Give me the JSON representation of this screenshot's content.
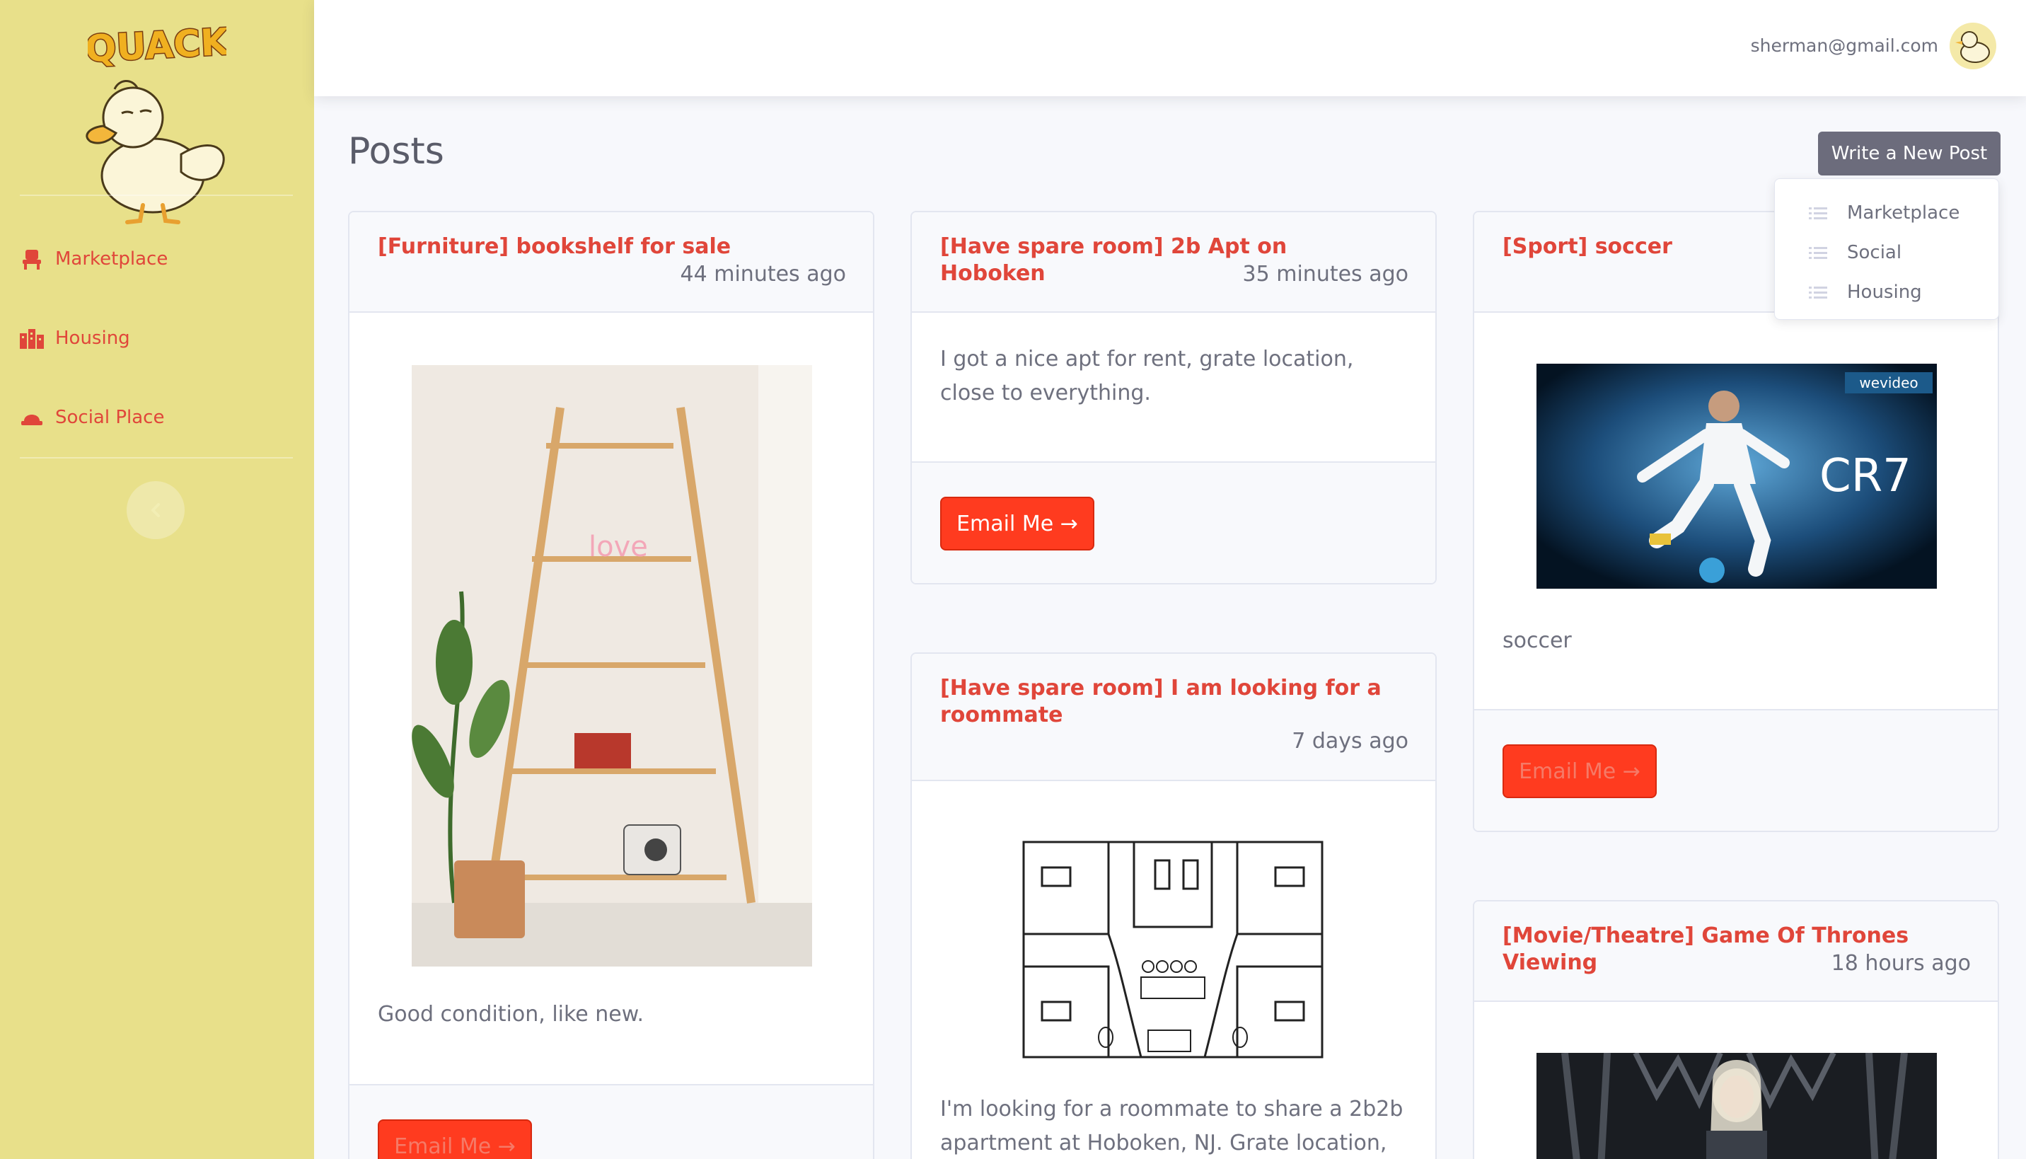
{
  "sidebar": {
    "logo_text": "QUACK",
    "items": [
      {
        "label": "Marketplace",
        "icon": "chair-icon"
      },
      {
        "label": "Housing",
        "icon": "city-icon"
      },
      {
        "label": "Social Place",
        "icon": "hat-icon"
      }
    ]
  },
  "topbar": {
    "user_email": "sherman@gmail.com"
  },
  "main": {
    "title": "Posts",
    "write_button": "Write a New Post",
    "dropdown": [
      "Marketplace",
      "Social",
      "Housing"
    ],
    "posts": [
      {
        "title": "[Furniture] bookshelf for sale",
        "time": "44 minutes ago",
        "body": "Good condition, like new.",
        "button": "Email Me →"
      },
      {
        "title": "[Have spare room] 2b Apt on Hoboken",
        "time": "35 minutes ago",
        "body": "I got a nice apt for rent, grate location, close to everything.",
        "button": "Email Me →"
      },
      {
        "title": "[Sport] soccer",
        "time": "",
        "body": "soccer",
        "button": "Email Me →",
        "image_text": "CR7",
        "watermark": "wevideo"
      },
      {
        "title": "[Have spare room] I am looking for a roommate",
        "time": "7 days ago",
        "body": "I'm looking for a roommate to share a 2b2b apartment at Hoboken, NJ. Grate location,",
        "button": ""
      },
      {
        "title": "[Movie/Theatre] Game Of Thrones Viewing",
        "time": "18 hours ago",
        "body": "",
        "button": ""
      }
    ]
  },
  "colors": {
    "sidebar_bg": "#e8e08a",
    "accent_red": "#e0463a",
    "button_red": "#ff3b1f",
    "write_button_bg": "#6c6c7c"
  }
}
